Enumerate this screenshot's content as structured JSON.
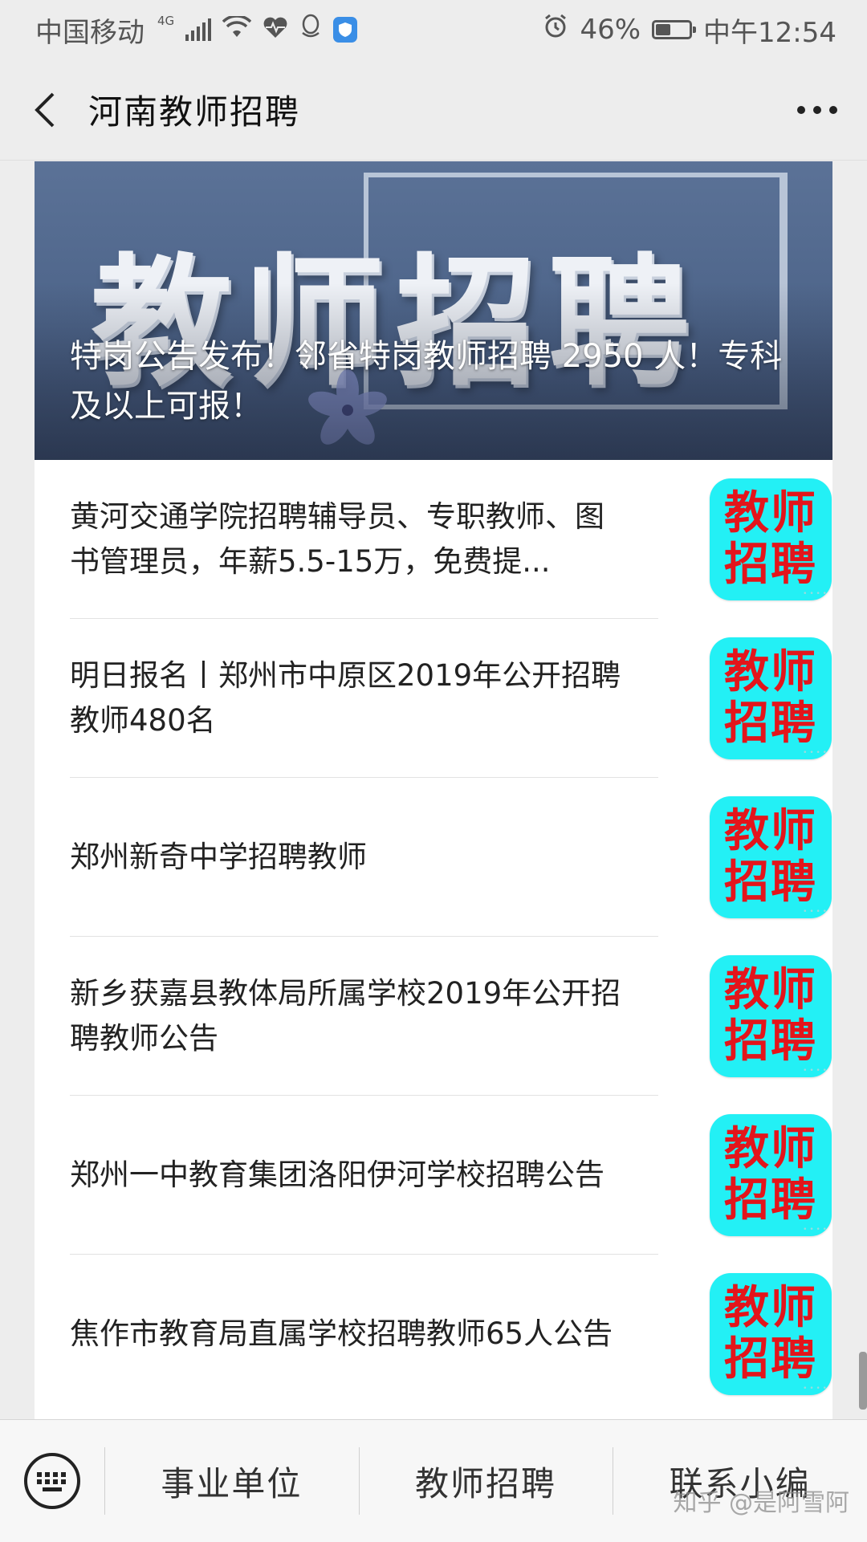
{
  "status_bar": {
    "carrier": "中国移动",
    "network": "4G",
    "battery": "46%",
    "battery_level": 0.46,
    "time": "中午12:54"
  },
  "nav": {
    "title": "河南教师招聘",
    "back_icon": "chevron-left-icon",
    "more_icon": "more-dots-icon"
  },
  "cover": {
    "image_text": "教师招聘",
    "title": "特岗公告发布！邻省特岗教师招聘 2950 人！专科及以上可报！"
  },
  "articles": [
    {
      "title": "黄河交通学院招聘辅导员、专职教师、图书管理员，年薪5.5-15万，免费提...",
      "thumb_line1": "教师",
      "thumb_line2": "招聘"
    },
    {
      "title": "明日报名丨郑州市中原区2019年公开招聘教师480名",
      "thumb_line1": "教师",
      "thumb_line2": "招聘"
    },
    {
      "title": "郑州新奇中学招聘教师",
      "thumb_line1": "教师",
      "thumb_line2": "招聘"
    },
    {
      "title": "新乡获嘉县教体局所属学校2019年公开招聘教师公告",
      "thumb_line1": "教师",
      "thumb_line2": "招聘"
    },
    {
      "title": "郑州一中教育集团洛阳伊河学校招聘公告",
      "thumb_line1": "教师",
      "thumb_line2": "招聘"
    },
    {
      "title": "焦作市教育局直属学校招聘教师65人公告",
      "thumb_line1": "教师",
      "thumb_line2": "招聘"
    }
  ],
  "bottom_menu": {
    "keyboard_icon": "keyboard-icon",
    "items": [
      "事业单位",
      "教师招聘",
      "联系小编"
    ]
  },
  "watermark": "知乎 @是阿雪阿",
  "colors": {
    "thumb_bg": "#23f0f5",
    "thumb_text": "#e3151b",
    "page_bg": "#ededed"
  }
}
